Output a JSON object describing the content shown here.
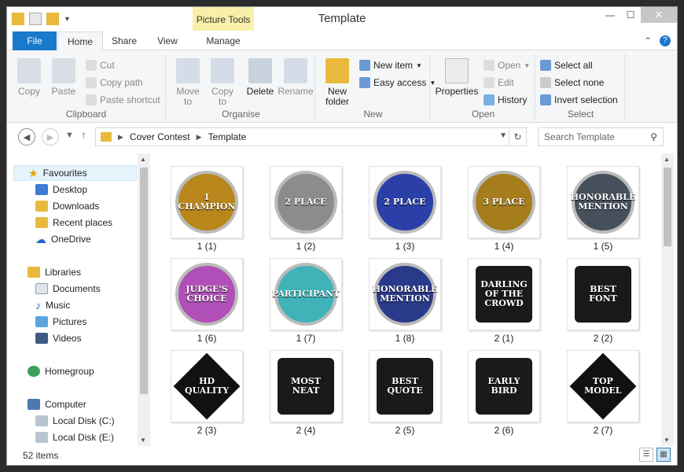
{
  "title": "Template",
  "picture_tools": "Picture Tools",
  "tabs": {
    "file": "File",
    "home": "Home",
    "share": "Share",
    "view": "View",
    "manage": "Manage"
  },
  "ribbon": {
    "clipboard": {
      "label": "Clipboard",
      "copy": "Copy",
      "paste": "Paste",
      "cut": "Cut",
      "copy_path": "Copy path",
      "paste_shortcut": "Paste shortcut"
    },
    "organise": {
      "label": "Organise",
      "move_to": "Move to",
      "copy_to": "Copy to",
      "delete": "Delete",
      "rename": "Rename"
    },
    "new": {
      "label": "New",
      "new_folder": "New folder",
      "new_item": "New item",
      "easy_access": "Easy access"
    },
    "open": {
      "label": "Open",
      "properties": "Properties",
      "open": "Open",
      "edit": "Edit",
      "history": "History"
    },
    "select": {
      "label": "Select",
      "select_all": "Select all",
      "select_none": "Select none",
      "invert": "Invert selection"
    }
  },
  "address": {
    "crumb1": "Cover Contest",
    "crumb2": "Template",
    "search_placeholder": "Search Template"
  },
  "nav": {
    "favourites": "Favourites",
    "desktop": "Desktop",
    "downloads": "Downloads",
    "recent": "Recent places",
    "onedrive": "OneDrive",
    "libraries": "Libraries",
    "documents": "Documents",
    "music": "Music",
    "pictures": "Pictures",
    "videos": "Videos",
    "homegroup": "Homegroup",
    "computer": "Computer",
    "disk_c": "Local Disk (C:)",
    "disk_e": "Local Disk (E:)"
  },
  "files": [
    {
      "name": "1 (1)",
      "text": "1 CHAMPION",
      "color": "#b8861b"
    },
    {
      "name": "1 (2)",
      "text": "2 PLACE",
      "color": "#8c8c8c"
    },
    {
      "name": "1 (3)",
      "text": "2 PLACE",
      "color": "#2a3fa8"
    },
    {
      "name": "1 (4)",
      "text": "3 PLACE",
      "color": "#a57d1c"
    },
    {
      "name": "1 (5)",
      "text": "HONORABLE MENTION",
      "color": "#46505c"
    },
    {
      "name": "1 (6)",
      "text": "JUDGE'S CHOICE",
      "color": "#b04fb8"
    },
    {
      "name": "1 (7)",
      "text": "PARTICIPANT",
      "color": "#3fb3b8"
    },
    {
      "name": "1 (8)",
      "text": "HONORABLE MENTION",
      "color": "#2a3a8a"
    },
    {
      "name": "2 (1)",
      "text": "DARLING OF THE CROWD",
      "color": "#1a1a1a"
    },
    {
      "name": "2 (2)",
      "text": "BEST FONT",
      "color": "#1a1a1a"
    },
    {
      "name": "2 (3)",
      "text": "HD QUALITY",
      "color": "#111111"
    },
    {
      "name": "2 (4)",
      "text": "MOST NEAT",
      "color": "#1a1a1a"
    },
    {
      "name": "2 (5)",
      "text": "BEST QUOTE",
      "color": "#1a1a1a"
    },
    {
      "name": "2 (6)",
      "text": "EARLY BIRD",
      "color": "#1a1a1a"
    },
    {
      "name": "2 (7)",
      "text": "TOP MODEL",
      "color": "#111111"
    }
  ],
  "status": {
    "count": "52 items"
  }
}
